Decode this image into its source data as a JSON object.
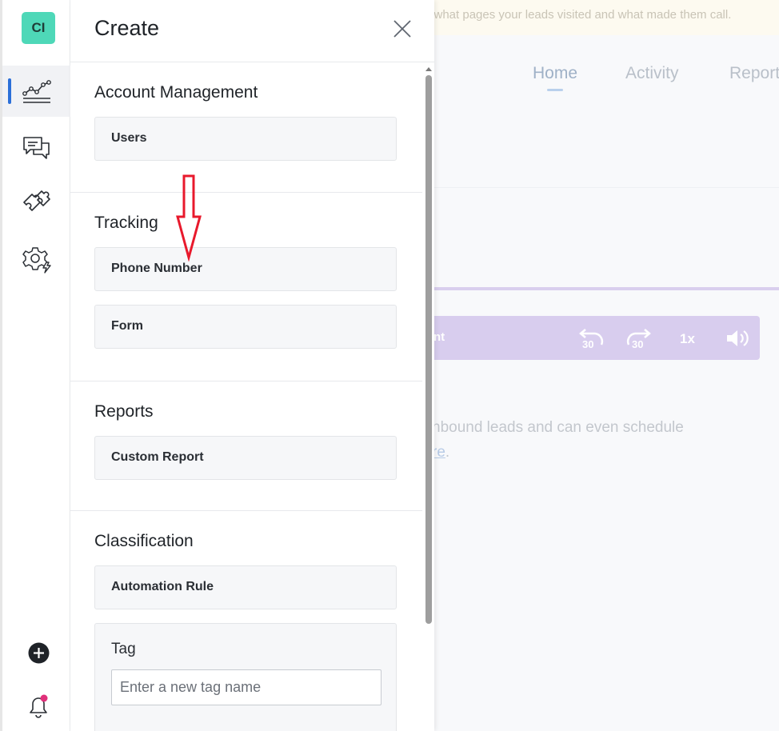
{
  "background": {
    "banner_text": "g what pages your leads visited and what made them call.",
    "tabs": [
      "Home",
      "Activity",
      "Report"
    ],
    "player": {
      "label": "nt",
      "rewind": "30",
      "forward": "30",
      "speed": "1x"
    },
    "body_line_1": "nbound leads and can even schedule",
    "body_line_2_link": "re",
    "body_line_2_end": "."
  },
  "rail": {
    "avatar_initials": "CI"
  },
  "panel": {
    "title": "Create",
    "sections": [
      {
        "title": "Account Management",
        "items": [
          "Users"
        ]
      },
      {
        "title": "Tracking",
        "items": [
          "Phone Number",
          "Form"
        ]
      },
      {
        "title": "Reports",
        "items": [
          "Custom Report"
        ]
      },
      {
        "title": "Classification",
        "items": [
          "Automation Rule"
        ]
      }
    ],
    "tag": {
      "title": "Tag",
      "placeholder": "Enter a new tag name"
    }
  },
  "colors": {
    "avatar": "#4ed8b8",
    "rail_active_indicator": "#2b6fd8",
    "annotation_arrow": "#e8192c",
    "notification_dot": "#e0307a"
  },
  "icons": {
    "rail": [
      "analytics-icon",
      "conversations-icon",
      "integrations-icon",
      "settings-icon"
    ],
    "bottom": [
      "add-circle-icon",
      "bell-icon"
    ],
    "panel": [
      "close-icon"
    ],
    "annotation": "down-arrow-icon"
  }
}
